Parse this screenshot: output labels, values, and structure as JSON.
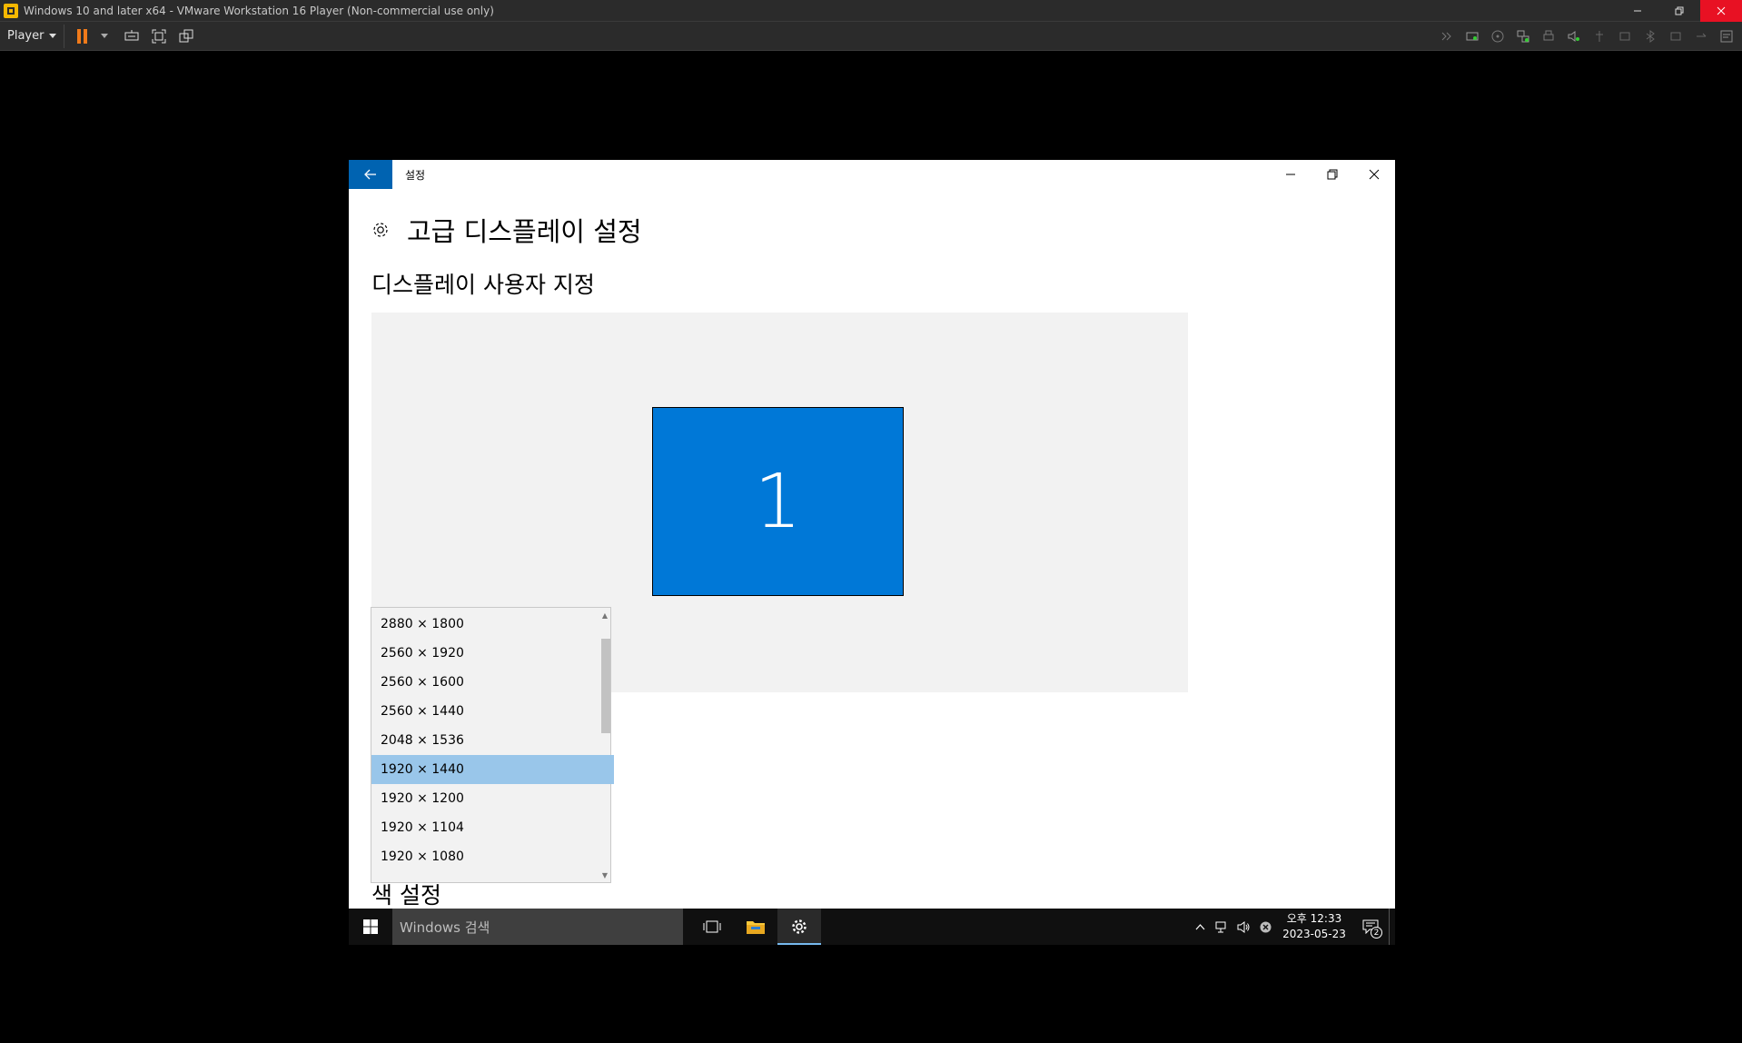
{
  "host": {
    "title": "Windows 10 and later x64 - VMware Workstation 16 Player (Non-commercial use only)",
    "player_menu_label": "Player",
    "accent_pause_color": "#f07a1a",
    "close_color": "#e81123"
  },
  "settings_window": {
    "title": "설정",
    "page_title": "고급 디스플레이 설정",
    "section_title": "디스플레이 사용자 지정",
    "monitor_label": "1",
    "accent_color": "#0078d7",
    "back_button_color": "#0063b1",
    "color_settings_title": "색 설정"
  },
  "resolution_dropdown": {
    "items": [
      {
        "label": "2880 × 1800"
      },
      {
        "label": "2560 × 1920"
      },
      {
        "label": "2560 × 1600"
      },
      {
        "label": "2560 × 1440"
      },
      {
        "label": "2048 × 1536"
      },
      {
        "label": "1920 × 1440",
        "selected": true
      },
      {
        "label": "1920 × 1200"
      },
      {
        "label": "1920 × 1104"
      },
      {
        "label": "1920 × 1080"
      }
    ],
    "selected_color": "#99c6ea"
  },
  "taskbar": {
    "search_placeholder": "Windows 검색",
    "clock_period": "오후 12:33",
    "clock_date": "2023-05-23",
    "notification_count": "2"
  }
}
